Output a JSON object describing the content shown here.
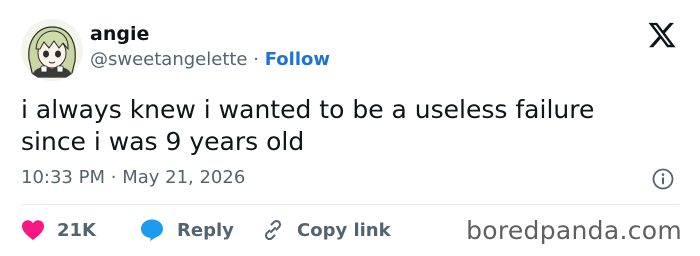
{
  "author": {
    "name": "angie",
    "handle": "@sweetangelette",
    "separator": "·",
    "follow_label": "Follow"
  },
  "platform_icon": "x-logo-icon",
  "tweet": {
    "text": "i always knew i wanted to be a useless failure\nsince i was 9 years old",
    "time": "10:33 PM",
    "date_separator": "·",
    "date": "May 21, 2026"
  },
  "actions": {
    "like_count": "21K",
    "reply_label": "Reply",
    "copy_label": "Copy link"
  },
  "watermark": "boredpanda.com",
  "colors": {
    "like": "#f91880",
    "reply": "#1d9bf0",
    "follow": "#1d72d6",
    "secondary_text": "#536471"
  }
}
